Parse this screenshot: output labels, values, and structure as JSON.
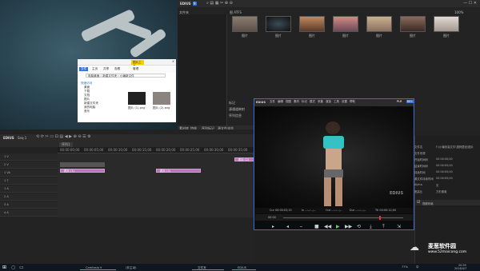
{
  "app": {
    "name": "EDIUS",
    "badge": "9"
  },
  "bin": {
    "tab_left": "文件夹",
    "search_tab": "文件夹",
    "folder_label": "图 ATFS",
    "zoom": "100%",
    "thumbs": [
      {
        "label": "图片"
      },
      {
        "label": "图片"
      },
      {
        "label": "图片"
      },
      {
        "label": "图片"
      },
      {
        "label": "图片"
      },
      {
        "label": "图片"
      },
      {
        "label": "图片"
      }
    ]
  },
  "explorer": {
    "tabs": [
      "文件",
      "主页",
      "共享",
      "查看"
    ],
    "highlight": "图片工具",
    "manage": "管理",
    "path": [
      "电脑桌面",
      "新建文件夹",
      "小编新文件"
    ],
    "nav": [
      "快速访问",
      "桌面",
      "下载",
      "文档",
      "图片",
      "新建文件夹",
      "我的电脑",
      "音乐"
    ],
    "files": [
      {
        "name": "图片 (1).png"
      },
      {
        "name": "图片 (2).png"
      }
    ]
  },
  "info_panel": {
    "items": [
      "标记",
      "源通道映射",
      "序列信息"
    ],
    "tabs": [
      "素材库",
      "特效",
      "序列标记",
      "源文件浏览"
    ]
  },
  "player": {
    "menus": [
      "文件",
      "编辑",
      "视图",
      "素材",
      "标记",
      "模式",
      "采集",
      "渲染",
      "工具",
      "设置",
      "帮助"
    ],
    "mode_label": "PLR",
    "mode_badge": "REC",
    "logo": "EDIUS",
    "tc_cur": "Cur 00:00:03;15",
    "tc_in": "In --:--:--;--",
    "tc_out": "Out --:--:--;--",
    "tc_dur": "Dur --:--:--;--",
    "tc_ttl": "Ttl 00:00:12;00",
    "range_start": "00:00"
  },
  "timeline": {
    "name": "EDIUS",
    "seq_label": "Seq 1",
    "seq_tab": "序列1",
    "ruler": [
      "00:00:00;00",
      "00:00:05;00",
      "00:00:10;00",
      "00:00:15;00",
      "00:00:20;00",
      "00:00:25;00",
      "00:00:30;00",
      "00:00:35;00"
    ],
    "tracks": [
      "1 V",
      "2 V",
      "1 VA",
      "1 T",
      "1 A",
      "2 A",
      "3 A",
      "4 A"
    ],
    "clips": [
      "图片 (1)",
      "图片 (2)",
      "图片 (2)"
    ]
  },
  "props": {
    "labels": [
      "文件名",
      "文件来源",
      "开始时间码",
      "结束时间码",
      "持续时间",
      "源文件持续时间",
      "Alpha",
      "宽高比"
    ],
    "values": [
      "F:\\小编安装文件\\搜狗壁纸\\图片",
      "",
      "00:00:00;00",
      "00:00:05;00",
      "00:00:05;00",
      "00:00:05;00",
      "无",
      "方形像素"
    ],
    "filter": "视频布局"
  },
  "taskbar": {
    "apps": [
      "Camtasia 9",
      "(非主动)",
      "文件夹",
      "EDIUS"
    ],
    "time": "20:59",
    "date": "2018/4/7",
    "lang": "中",
    "battery": "77%"
  },
  "watermark": {
    "name": "麦葱软件园",
    "url": "www.52maicong.com"
  },
  "colors": {
    "accent": "#2f6fd6",
    "clip": "#b777b9",
    "bg": "#1a1a1a"
  }
}
